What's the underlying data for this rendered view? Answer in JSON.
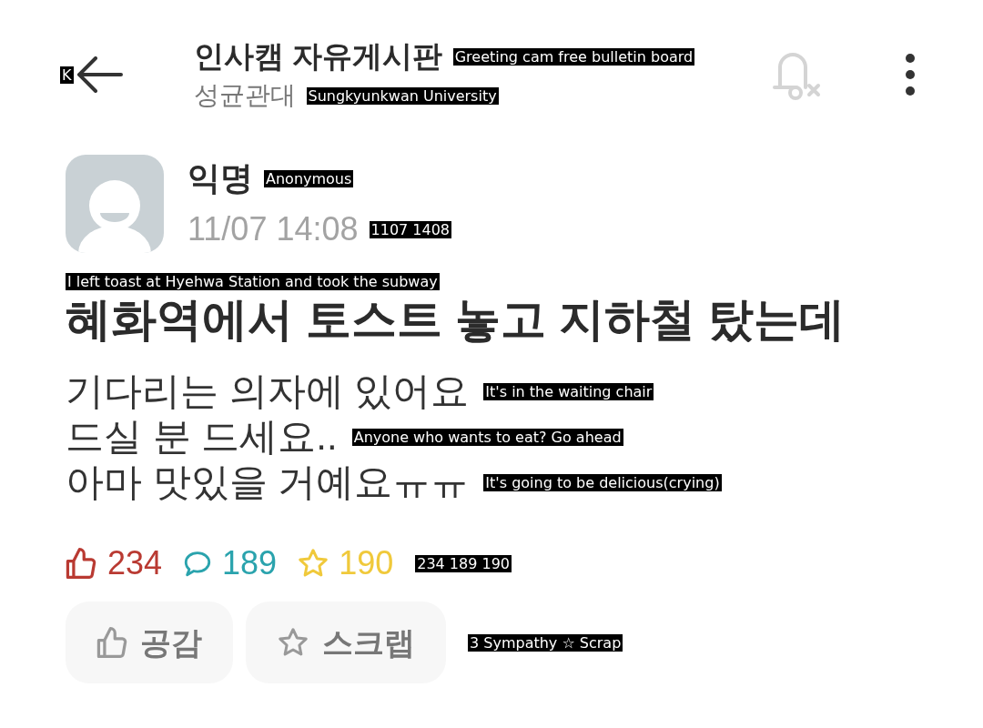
{
  "header": {
    "back_label": "K",
    "board": "인사캠 자유게시판",
    "board_translation": "Greeting cam free bulletin board",
    "school": "성균관대",
    "school_translation": "Sungkyunkwan University"
  },
  "author": {
    "name": "익명",
    "name_translation": "Anonymous",
    "date": "11/07 14:08",
    "date_translation": "1107 1408"
  },
  "post": {
    "title": "혜화역에서 토스트 놓고 지하철 탔는데",
    "title_translation": "I left toast at Hyehwa Station and took the subway",
    "lines": [
      {
        "text": "기다리는 의자에 있어요",
        "translation": "It's in the waiting chair"
      },
      {
        "text": "드실 분 드세요..",
        "translation": "Anyone who wants to eat? Go ahead"
      },
      {
        "text": "아마 맛있을 거예요ㅠㅠ",
        "translation": "It's going to be delicious(crying)"
      }
    ]
  },
  "stats": {
    "likes": "234",
    "comments": "189",
    "scraps": "190",
    "translation": "234 189 190"
  },
  "actions": {
    "buttons": [
      {
        "kind": "like",
        "label": "공감"
      },
      {
        "kind": "scrap",
        "label": "스크랩"
      }
    ],
    "translation": "3 Sympathy ☆ Scrap"
  }
}
